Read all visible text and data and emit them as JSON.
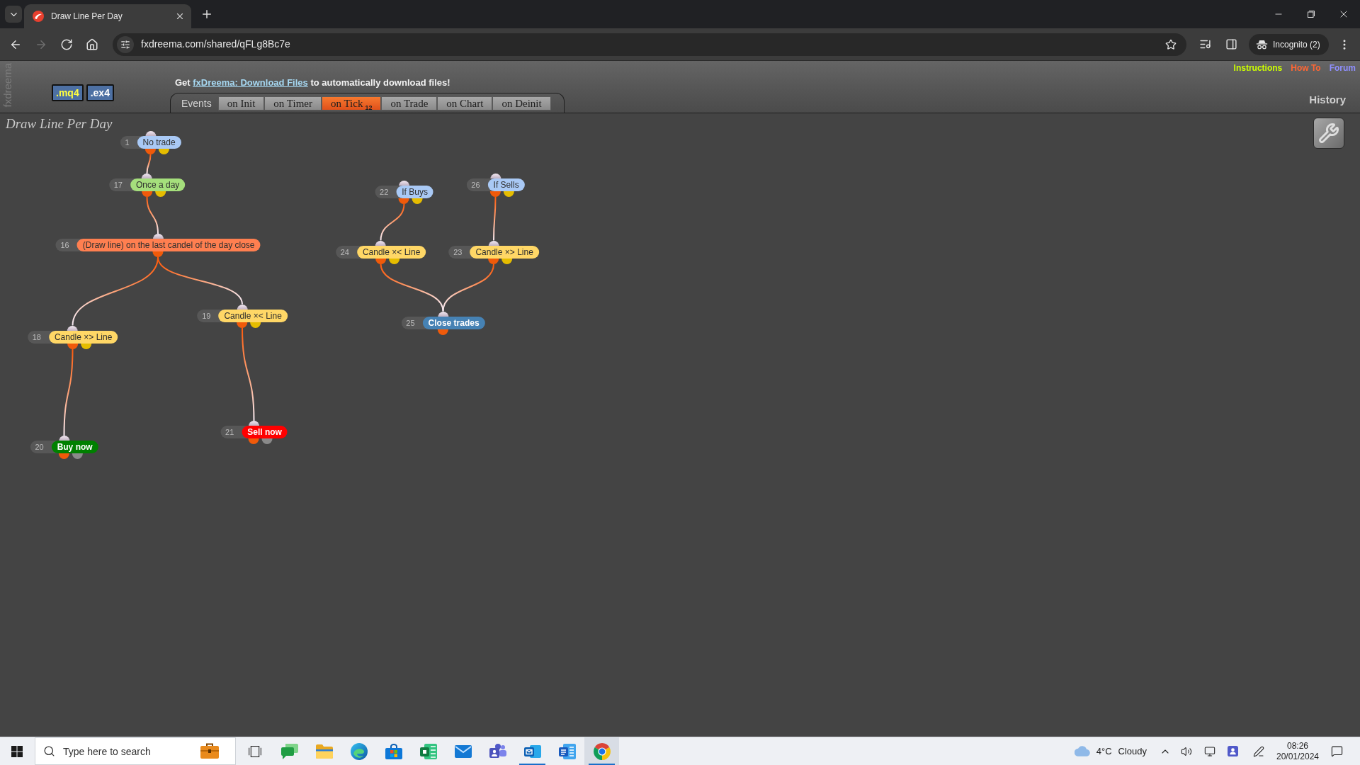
{
  "browser": {
    "tabs": [
      {
        "title": "Draw Line Per Day",
        "selected": true
      }
    ],
    "nav_buttons": [
      {
        "kind": "back",
        "disabled": false
      },
      {
        "kind": "forward",
        "disabled": true
      },
      {
        "kind": "reload",
        "disabled": false
      },
      {
        "kind": "home",
        "disabled": false
      }
    ],
    "url": "fxdreema.com/shared/qFLg8Bc7e",
    "profile": "Incognito (2)"
  },
  "header": {
    "side_label": "fxdreema",
    "file_types": [
      {
        "label": ".mq4",
        "selected": true
      },
      {
        "label": ".ex4",
        "selected": false
      }
    ],
    "notice": {
      "before": "Get",
      "link": "fxDreema: Download Files",
      "after": "to automatically download files!"
    },
    "events_label": "Events",
    "tabs": [
      {
        "label": "on Init",
        "selected": false
      },
      {
        "label": "on Timer",
        "selected": false
      },
      {
        "label": "on Tick",
        "badge": "12",
        "selected": true
      },
      {
        "label": "on Trade",
        "selected": false
      },
      {
        "label": "on Chart",
        "selected": false
      },
      {
        "label": "on Deinit",
        "selected": false
      }
    ],
    "links": [
      {
        "label": "Instructions",
        "color": "#ccff00"
      },
      {
        "label": "How To",
        "color": "#ff6633"
      },
      {
        "label": "Forum",
        "color": "#8f8fff"
      }
    ],
    "history": "History"
  },
  "canvas": {
    "title": "Draw Line Per Day",
    "nodes": [
      {
        "number": "1",
        "label": "No trade",
        "color": "#a9c9f5",
        "outputs": [
          {
            "color": "#f05a0a"
          },
          {
            "color": "#e6bd00"
          }
        ]
      },
      {
        "number": "17",
        "label": "Once a day",
        "color": "#a5df7c",
        "outputs": [
          {
            "color": "#f05a0a"
          },
          {
            "color": "#e6bd00"
          }
        ]
      },
      {
        "number": "16",
        "label": "(Draw line) on the last candel of the day close",
        "color": "#ff7f50",
        "outputs": [
          {
            "color": "#f05a0a"
          }
        ]
      },
      {
        "number": "18",
        "label": "Candle ×> Line",
        "color": "#ffd766",
        "outputs": [
          {
            "color": "#f05a0a"
          },
          {
            "color": "#e6bd00"
          }
        ]
      },
      {
        "number": "19",
        "label": "Candle ×< Line",
        "color": "#ffd766",
        "outputs": [
          {
            "color": "#f05a0a"
          },
          {
            "color": "#e6bd00"
          }
        ]
      },
      {
        "number": "20",
        "label": "Buy now",
        "color": "#008000",
        "outputs": [
          {
            "color": "#f05a0a"
          },
          {
            "color": "#8a8a8a"
          }
        ]
      },
      {
        "number": "21",
        "label": "Sell now",
        "color": "#ff0000",
        "outputs": [
          {
            "color": "#f05a0a"
          },
          {
            "color": "#8a8a8a"
          }
        ]
      },
      {
        "number": "22",
        "label": "If Buys",
        "color": "#a9c9f5",
        "outputs": [
          {
            "color": "#f05a0a"
          },
          {
            "color": "#e6bd00"
          }
        ]
      },
      {
        "number": "26",
        "label": "If Sells",
        "color": "#a9c9f5",
        "outputs": [
          {
            "color": "#f05a0a"
          },
          {
            "color": "#e6bd00"
          }
        ]
      },
      {
        "number": "24",
        "label": "Candle ×< Line",
        "color": "#ffd766",
        "outputs": [
          {
            "color": "#f05a0a"
          },
          {
            "color": "#e6bd00"
          }
        ]
      },
      {
        "number": "23",
        "label": "Candle ×> Line",
        "color": "#ffd766",
        "outputs": [
          {
            "color": "#f05a0a"
          },
          {
            "color": "#e6bd00"
          }
        ]
      },
      {
        "number": "25",
        "label": "Close trades",
        "color": "#4682b4",
        "outputs": [
          {
            "color": "#f05a0a"
          }
        ]
      }
    ]
  },
  "taskbar": {
    "search": {
      "placeholder": "Type here to search"
    },
    "apps": [
      {
        "kind": "chat",
        "running": false,
        "selected": false
      },
      {
        "kind": "folder",
        "running": false,
        "selected": false
      },
      {
        "kind": "swirl",
        "running": false,
        "selected": false
      },
      {
        "kind": "bag",
        "running": false,
        "selected": false
      },
      {
        "kind": "spreadsheet",
        "running": false,
        "selected": false
      },
      {
        "kind": "mail",
        "running": false,
        "selected": false
      },
      {
        "kind": "people",
        "running": false,
        "selected": false
      },
      {
        "kind": "mail-tile",
        "running": true,
        "selected": false
      },
      {
        "kind": "document",
        "running": false,
        "selected": false
      },
      {
        "kind": "ring",
        "running": true,
        "selected": true
      }
    ],
    "weather": {
      "temperature": "4°C",
      "condition": "Cloudy"
    },
    "time": "08:26",
    "date": "20/01/2024"
  }
}
